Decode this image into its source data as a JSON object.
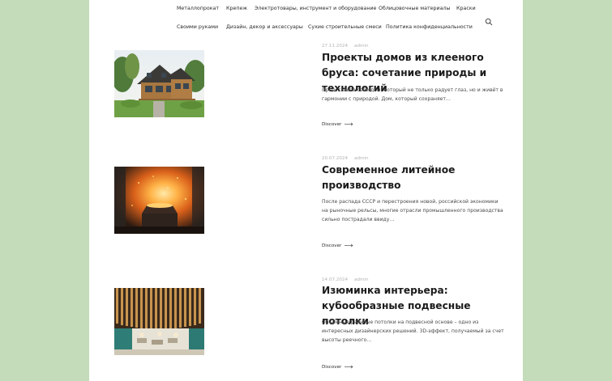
{
  "nav": {
    "row1": [
      "Металлопрокат",
      "Крепеж",
      "Электротовары, инструмент и оборудование",
      "Облицовочные материалы",
      "Краски"
    ],
    "row2": [
      "Своими руками",
      "Дизайн, декор и аксессуары",
      "Сухие строительные смеси",
      "Политика конфиденциальности"
    ],
    "search_icon": "search-icon"
  },
  "posts": [
    {
      "date": "27.11.2024",
      "author": "admin",
      "title": "Проекты домов из клееного бруса: сочетание природы и технологий",
      "excerpt": "Представьте себе дом, который не только радует глаз, но и живёт в гармонии с природой. Дом, который сохраняет…",
      "discover": "Discover",
      "image": "wooden-house-image"
    },
    {
      "date": "20.07.2024",
      "author": "admin",
      "title": "Современное литейное производство",
      "excerpt": "После распада СССР и перестроения новой, российской экономики на рыночные рельсы, многие отрасли промышленного производства сильно пострадали ввиду…",
      "discover": "Discover",
      "image": "foundry-image"
    },
    {
      "date": "14.07.2024",
      "author": "admin",
      "title": "Изюминка интерьера: кубообразные подвесные потолки",
      "excerpt": "Объемные реечные потолки на подвесной основе – одно из интересных дизайнерских решений. 3D-эффект, получаемый за счет высоты реечного…",
      "discover": "Discover",
      "image": "slatted-ceiling-image"
    }
  ],
  "colors": {
    "page_bg": "#c4dcb9",
    "content_bg": "#ffffff",
    "meta_text": "#b3b3b3"
  }
}
